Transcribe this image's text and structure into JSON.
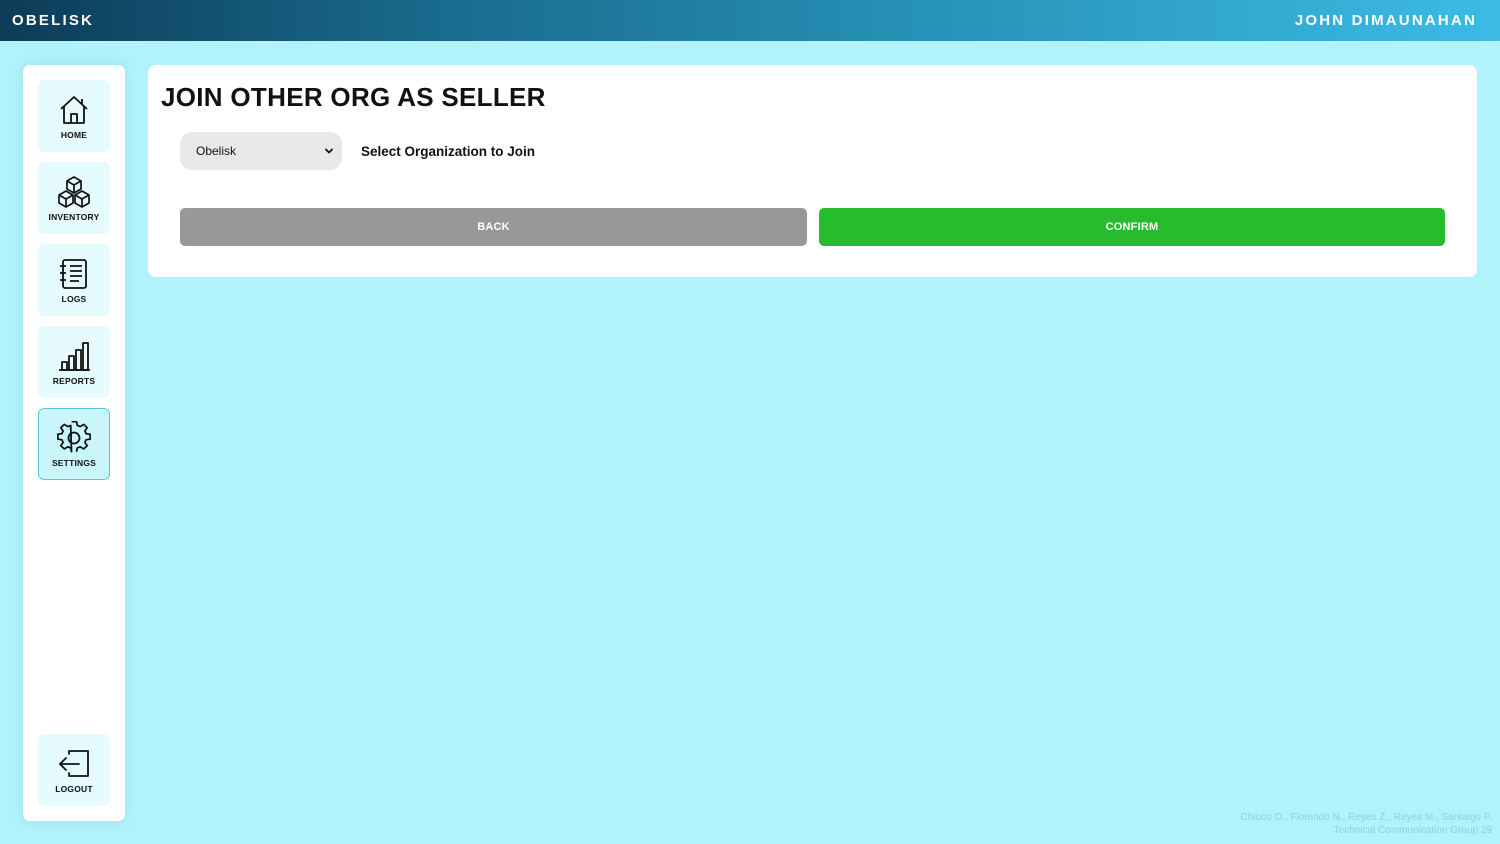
{
  "header": {
    "brand": "OBELISK",
    "user": "JOHN DIMAUNAHAN"
  },
  "sidebar": {
    "items": [
      {
        "label": "HOME",
        "icon": "home-icon",
        "active": false
      },
      {
        "label": "INVENTORY",
        "icon": "boxes-icon",
        "active": false
      },
      {
        "label": "LOGS",
        "icon": "notebook-icon",
        "active": false
      },
      {
        "label": "REPORTS",
        "icon": "bar-chart-icon",
        "active": false
      },
      {
        "label": "SETTINGS",
        "icon": "gear-icon",
        "active": true
      }
    ],
    "logout": {
      "label": "LOGOUT",
      "icon": "logout-icon"
    }
  },
  "main": {
    "title": "JOIN OTHER ORG AS SELLER",
    "org_select": {
      "value": "Obelisk",
      "label": "Select Organization to Join"
    },
    "back_label": "BACK",
    "confirm_label": "CONFIRM"
  },
  "footer": {
    "line1": "Chiuco O., Florendo N., Reyes Z., Reyes M., Santaigo P.",
    "line2": "Technical Communication Group 29"
  },
  "colors": {
    "background": "#b2f3fb",
    "back_button": "#989898",
    "confirm_button": "#26bc2c",
    "active_nav_border": "#5fc6d8"
  }
}
